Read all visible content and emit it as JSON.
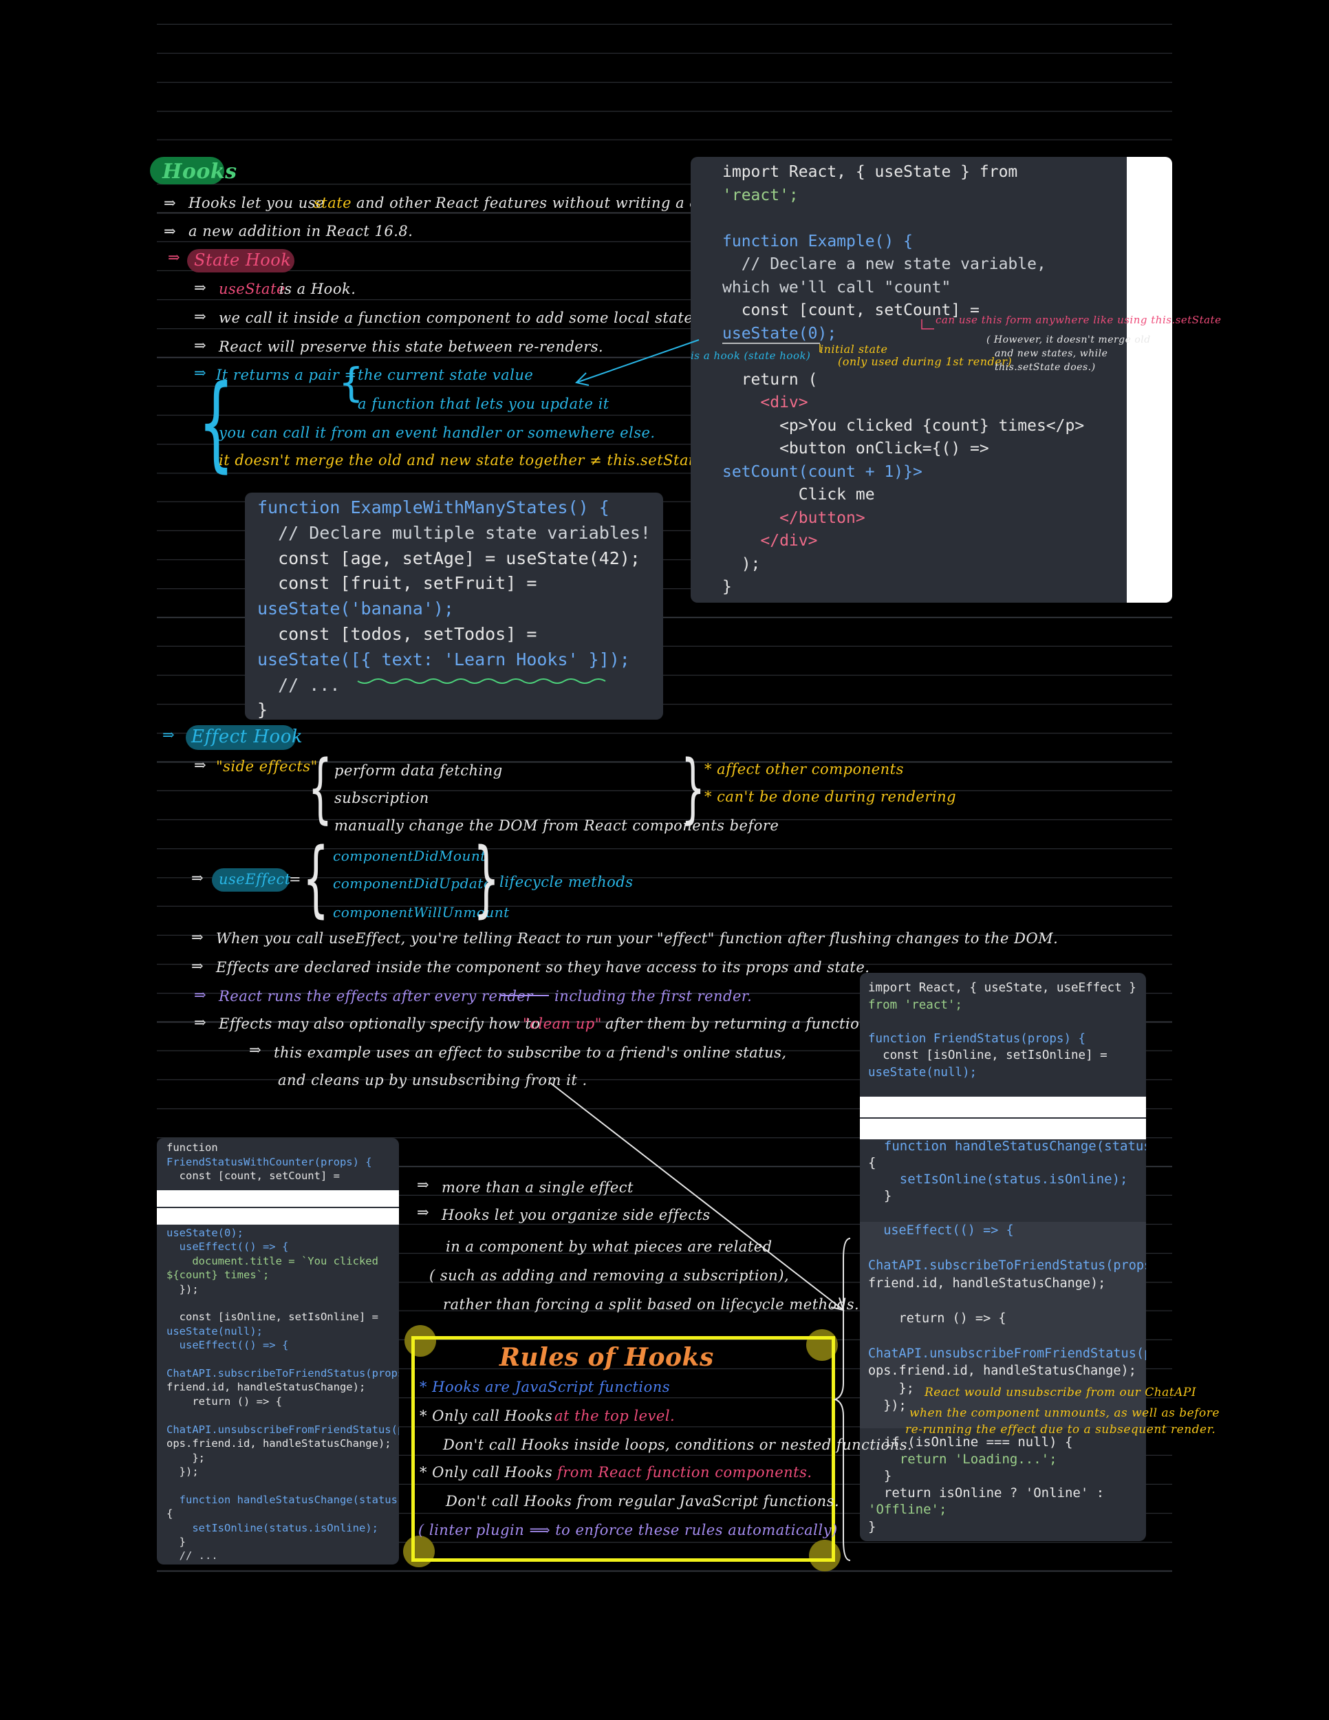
{
  "hooks": {
    "title": "Hooks",
    "lines": [
      "Hooks let you use",
      "state",
      "and other React features without writing a class.",
      "a new addition in React 16.8."
    ]
  },
  "state_hook": {
    "title": "State Hook",
    "lines": {
      "l1a": "useState",
      "l1b": "is a Hook.",
      "l2": "we call it inside a function component to add some local state to it.",
      "l3": "React will preserve this state between re-renders.",
      "l4a": "It returns a pair =",
      "l4b": "the current state value",
      "l5": "a function that lets you update it",
      "l6": "you can call it from an event handler or somewhere else.",
      "l7": "it doesn't merge the old and new state together ≠ this.setState"
    }
  },
  "code1": {
    "lines": [
      [
        "import React, { useState } from"
      ],
      [
        "'react';"
      ],
      [
        ""
      ],
      [
        "function Example() {"
      ],
      [
        "  // Declare a new state variable,"
      ],
      [
        "which we'll call \"count\""
      ],
      [
        "  const [count, setCount] ="
      ],
      [
        "useState(0);"
      ],
      [
        ""
      ],
      [
        "  return ("
      ],
      [
        "    <div>"
      ],
      [
        "      <p>You clicked {count} times</p>"
      ],
      [
        "      <button onClick={() =>"
      ],
      [
        "setCount(count + 1)}>"
      ],
      [
        "        Click me"
      ],
      [
        "      </button>"
      ],
      [
        "    </div>"
      ],
      [
        "  );"
      ],
      [
        "}"
      ]
    ],
    "annotations": {
      "hook_label": "is a hook (state hook)",
      "initial_state": "initial state",
      "initial_state_note": "(only used during 1st render)",
      "any_name": "can use this form anywhere like using this.setState",
      "however": "( However, it doesn't merge old",
      "however2": "and new states, while",
      "however3": "this.setState does.)"
    }
  },
  "code2": {
    "lines": [
      "function ExampleWithManyStates() {",
      "  // Declare multiple state variables!",
      "  const [age, setAge] = useState(42);",
      "  const [fruit, setFruit] =",
      "useState('banana');",
      "  const [todos, setTodos] =",
      "useState([{ text: 'Learn Hooks' }]);",
      "  // ...",
      "}"
    ]
  },
  "effect_hook": {
    "title": "Effect Hook",
    "side_effects": "\"side effects\"",
    "se_items": [
      "perform data fetching",
      "subscription",
      "manually change the DOM from React components before"
    ],
    "se_notes": [
      "* affect other components",
      "* can't be done during rendering"
    ],
    "use_effect": "useEffect",
    "eq": "=",
    "lifecycle": [
      "componentDidMount",
      "componentDidUpdate",
      "componentWillUnmount"
    ],
    "lifecycle_label": "lifecycle methods",
    "notes": {
      "n1": "When you call useEffect, you're telling React to run your \"effect\" function after flushing changes to the DOM.",
      "n2": "Effects are declared inside the component so they have access to its props and state.",
      "n3a": "React runs the effects after every render",
      "n3b": "including the first render.",
      "n4a": "Effects may also optionally specify how to",
      "n4b": "\"clean up\"",
      "n4c": "after them by returning a function.",
      "n5": "this example uses an effect to subscribe to a friend's online status,",
      "n6": "and cleans up by unsubscribing from it ."
    }
  },
  "code3": {
    "top": [
      "import React, { useState, useEffect }",
      "from 'react';",
      "",
      "function FriendStatus(props) {",
      "  const [isOnline, setIsOnline] =",
      "useState(null);"
    ],
    "mid": [
      "  function handleStatusChange(status)",
      "{",
      "    setIsOnline(status.isOnline);",
      "  }"
    ],
    "effect": [
      "  useEffect(() => {",
      "",
      "ChatAPI.subscribeToFriendStatus(props.",
      "friend.id, handleStatusChange);",
      "",
      "    return () => {",
      "",
      "ChatAPI.unsubscribeFromFriendStatus(pr",
      "ops.friend.id, handleStatusChange);",
      "    };",
      "  });"
    ],
    "bottom": [
      "  if (isOnline === null) {",
      "    return 'Loading...';",
      "  }",
      "  return isOnline ? 'Online' :",
      "'Offline';",
      "}"
    ],
    "note1": "React would unsubscribe from our ChatAPI",
    "note2": "when the component unmounts, as well as before",
    "note3": "re-running the effect due to a subsequent render."
  },
  "code4": {
    "top": [
      "function",
      "FriendStatusWithCounter(props) {",
      "  const [count, setCount] ="
    ],
    "rest": [
      "useState(0);",
      "  useEffect(() => {",
      "    document.title = `You clicked",
      "${count} times`;",
      "  });",
      "",
      "  const [isOnline, setIsOnline] =",
      "useState(null);",
      "  useEffect(() => {",
      "",
      "ChatAPI.subscribeToFriendStatus(props.",
      "friend.id, handleStatusChange);",
      "    return () => {",
      "",
      "ChatAPI.unsubscribeFromFriendStatus(pr",
      "ops.friend.id, handleStatusChange);",
      "    };",
      "  });",
      "",
      "  function handleStatusChange(status)",
      "{",
      "    setIsOnline(status.isOnline);",
      "  }",
      "  // ..."
    ]
  },
  "multi_effect": {
    "m1": "more than a single effect",
    "m2": "Hooks let you organize side effects",
    "m3": "in a component by what pieces are related",
    "m4": "( such as adding and removing a subscription),",
    "m5": "rather than forcing a split based on lifecycle methods."
  },
  "rules": {
    "title": "Rules of Hooks",
    "r1": "* Hooks are JavaScript functions",
    "r2a": "* Only call Hooks",
    "r2b": "at the top level.",
    "r3": "Don't call Hooks inside loops, conditions or nested functions.",
    "r4a": "* Only call Hooks",
    "r4b": "from React function components.",
    "r5": "Don't call Hooks from regular JavaScript functions.",
    "r6": "( linter plugin ⟹ to enforce these rules automatically)"
  },
  "arrow": "⇒",
  "colors": {
    "white": "#e8e8e8",
    "yellow": "#f5c518",
    "cyan": "#29b6e6",
    "pink": "#ee4c7a",
    "violet": "#a58cf0",
    "blue": "#4a7ef0",
    "orange": "#f08a3c",
    "green": "#4cd07a",
    "code_bg": "#2b2f37"
  }
}
